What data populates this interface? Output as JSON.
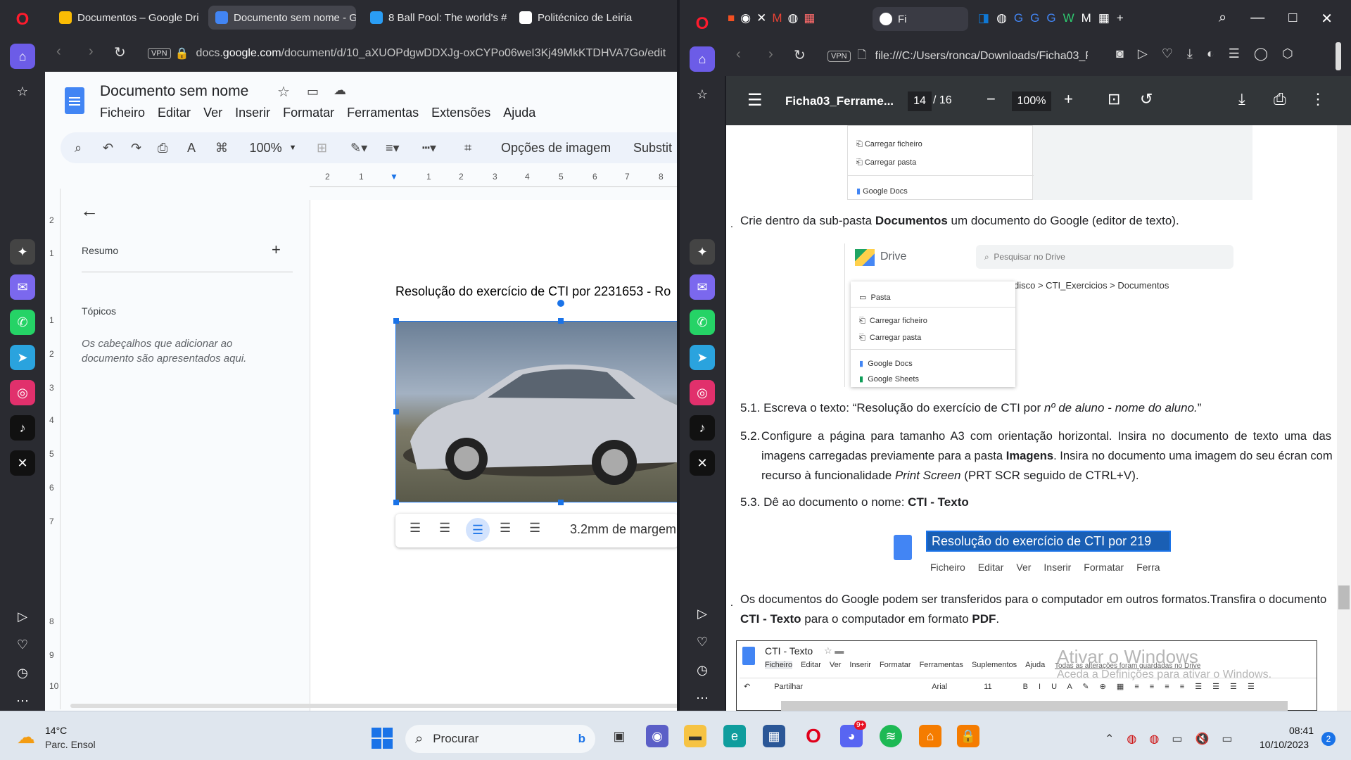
{
  "left_browser": {
    "tabs": [
      {
        "label": "Documentos – Google Dri"
      },
      {
        "label": "Documento sem nome - G"
      },
      {
        "label": "8 Ball Pool: The world's #1"
      },
      {
        "label": "Politécnico de Leiria"
      }
    ],
    "url_prefix": "docs.",
    "url_domain": "google.com",
    "url_rest": "/document/d/10_aXUOPdgwDDXJg-oxCYPo06weI3Kj49MkKTDHVA7Go/edit",
    "vpn": "VPN"
  },
  "docs": {
    "title": "Documento sem nome",
    "menu": [
      "Ficheiro",
      "Editar",
      "Ver",
      "Inserir",
      "Formatar",
      "Ferramentas",
      "Extensões",
      "Ajuda"
    ],
    "zoom": "100%",
    "image_options": "Opções de imagem",
    "replace": "Substit",
    "ruler_numbers": [
      "2",
      "1",
      "1",
      "2",
      "3",
      "4",
      "5",
      "6",
      "7",
      "8"
    ],
    "vruler_numbers": [
      "2",
      "1",
      "1",
      "2",
      "3",
      "4",
      "5",
      "6",
      "7",
      "8",
      "9",
      "10",
      "11",
      "12"
    ],
    "outline": {
      "summary": "Resumo",
      "topics": "Tópicos",
      "empty_text": "Os cabeçalhos que adicionar ao documento são apresentados aqui."
    },
    "body_text": "Resolução do exercício de CTI por 2231653 - Ro",
    "image_toolbar_margin": "3.2mm de margem"
  },
  "right_browser": {
    "url": "file:///C:/Users/ronca/Downloads/Ficha03_F",
    "vpn": "VPN",
    "tab_label": "Fi"
  },
  "pdf": {
    "filename": "Ficha03_Ferrame...",
    "page_current": "14",
    "page_total": "/ 16",
    "zoom": "100%",
    "top_menu": [
      "Carregar ficheiro",
      "Carregar pasta",
      "Google Docs"
    ],
    "para4_a": "Crie dentro da sub-pasta ",
    "para4_b": "Documentos",
    "para4_c": " um documento do Google (editor de texto).",
    "drive": {
      "logo": "Drive",
      "search": "Pesquisar no Drive",
      "breadcrumb": "disco  >  CTI_Exercicios  >  Documentos",
      "menu": [
        "Pasta",
        "Carregar ficheiro",
        "Carregar pasta",
        "Google Docs",
        "Google Sheets"
      ]
    },
    "item51_num": "5.1.",
    "item51_a": "Escreva o texto: “Resolução do exercício de CTI por ",
    "item51_b": "nº de aluno - nome do aluno.",
    "item51_c": "”",
    "item52_num": "5.2.",
    "item52_l1": "Configure a página para tamanho A3 com orientação horizontal. Insira no documento de texto uma das",
    "item52_l2a": "imagens carregadas previamente para a pasta ",
    "item52_l2b": "Imagens",
    "item52_l2c": ". Insira no documento uma imagem do seu écran com",
    "item52_l3a": "recurso à funcionalidade ",
    "item52_l3b": "Print Screen",
    "item52_l3c": " (PRT SCR seguido de CTRL+V).",
    "item53_num": "5.3.",
    "item53_a": "Dê ao documento o nome: ",
    "item53_b": "CTI - Texto",
    "docs_shot_title": "Resolução do exercício de CTI por 219",
    "docs_shot_menu": [
      "Ficheiro",
      "Editar",
      "Ver",
      "Inserir",
      "Formatar",
      "Ferra"
    ],
    "para6_a": "Os documentos do Google podem ser transferidos para o computador em outros formatos.Transfira o documento",
    "para6_b": "CTI - Texto",
    "para6_c": " para o computador em formato ",
    "para6_d": "PDF",
    "para6_e": ".",
    "bottom_shot": {
      "title": "CTI - Texto",
      "menu": [
        "Ficheiro",
        "Editar",
        "Ver",
        "Inserir",
        "Formatar",
        "Ferramentas",
        "Suplementos",
        "Ajuda"
      ],
      "saved": "Todas as alterações foram guardadas no Drive",
      "share": "Partilhar",
      "font": "Arial",
      "size": "11"
    },
    "watermark_l1": "Ativar o Windows",
    "watermark_l2": "Aceda a Definições para ativar o Windows."
  },
  "taskbar": {
    "temp": "14°C",
    "weather": "Parc. Ensol",
    "search": "Procurar",
    "time": "08:41",
    "date": "10/10/2023",
    "badge": "9+",
    "notif": "2"
  }
}
